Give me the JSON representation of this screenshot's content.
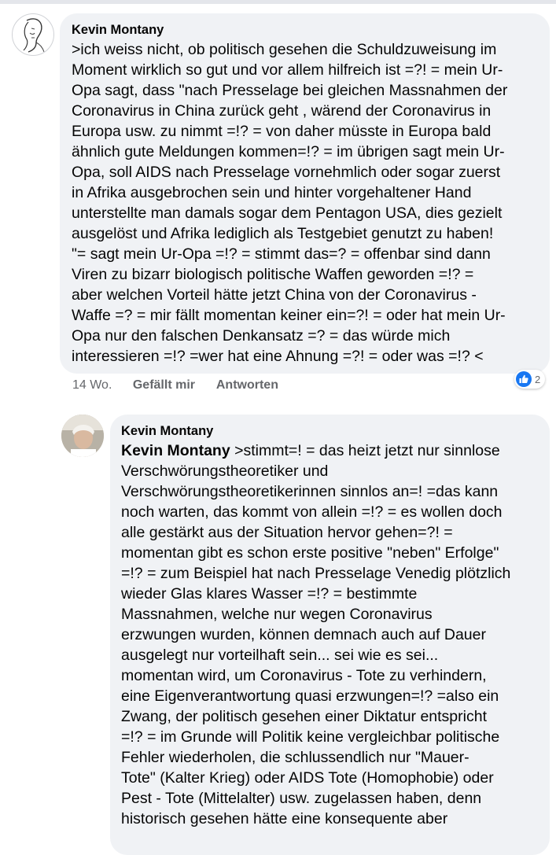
{
  "comment": {
    "author": "Kevin Montany",
    "text": ">ich weiss nicht, ob politisch gesehen  die Schuldzuweisung im\nMoment wirklich so gut und vor allem hilfreich ist =?! = mein Ur-\nOpa sagt, dass \"nach Presselage  bei gleichen Massnahmen der\nCoronavirus in China zurück geht , wärend der Coronavirus in\nEuropa usw. zu nimmt =!? = von daher müsste in Europa bald\nähnlich gute Meldungen kommen=!? = im übrigen sagt mein Ur-\nOpa, soll AIDS nach Presselage vornehmlich oder sogar zuerst\nin Afrika ausgebrochen sein und hinter vorgehaltener Hand\nunterstellte man  damals sogar dem Pentagon  USA, dies gezielt\nausgelöst und Afrika lediglich  als Testgebiet genutzt zu haben!\n\"= sagt mein Ur-Opa =!? = stimmt das=? = offenbar sind dann\nViren zu bizarr biologisch politische Waffen geworden =!? =\naber welchen Vorteil hätte jetzt  China von der Coronavirus -\nWaffe =? = mir fällt momentan keiner ein=?! = oder hat mein Ur-\nOpa nur den falschen Denkansatz =? = das würde mich\ninteressieren =!? =wer hat eine Ahnung =?! = oder was =!? <",
    "time": "14 Wo.",
    "like_label": "Gefällt mir",
    "reply_label": "Antworten",
    "reaction_count": "2"
  },
  "reply": {
    "author": "Kevin Montany",
    "mention": "Kevin Montany",
    "text": " >stimmt=! = das heizt jetzt nur sinnlose\nVerschwörungstheoretiker und\nVerschwörungstheoretikerinnen sinnlos an=! =das kann\nnoch warten, das kommt von allein =!? =  es wollen doch\nalle gestärkt aus der Situation hervor gehen=?! =\nmomentan gibt es schon erste  positive \"neben\" Erfolge\"\n=!? = zum Beispiel hat nach Presselage Venedig plötzlich\nwieder Glas klares Wasser =!? = bestimmte\nMassnahmen, welche nur wegen Coronavirus\nerzwungen wurden, können demnach auch auf Dauer\nausgelegt nur vorteilhaft sein... sei wie es sei...\nmomentan wird, um Coronavirus - Tote zu verhindern,\neine Eigenverantwortung quasi erzwungen=!? =also ein\nZwang, der politisch gesehen einer Diktatur entspricht\n=!? = im Grunde will Politik keine vergleichbar politische\nFehler wiederholen, die schlussendlich nur \"Mauer-\nTote\" (Kalter Krieg) oder AIDS Tote (Homophobie) oder\nPest - Tote (Mittelalter) usw. zugelassen haben, denn\nhistorisch gesehen hätte eine konsequente aber"
  },
  "colors": {
    "bubble": "#f0f2f5",
    "meta_text": "#65676b",
    "like_blue": "#1877f2",
    "text": "#050505"
  },
  "icons": {
    "reaction": "like-thumbs-up-icon"
  }
}
